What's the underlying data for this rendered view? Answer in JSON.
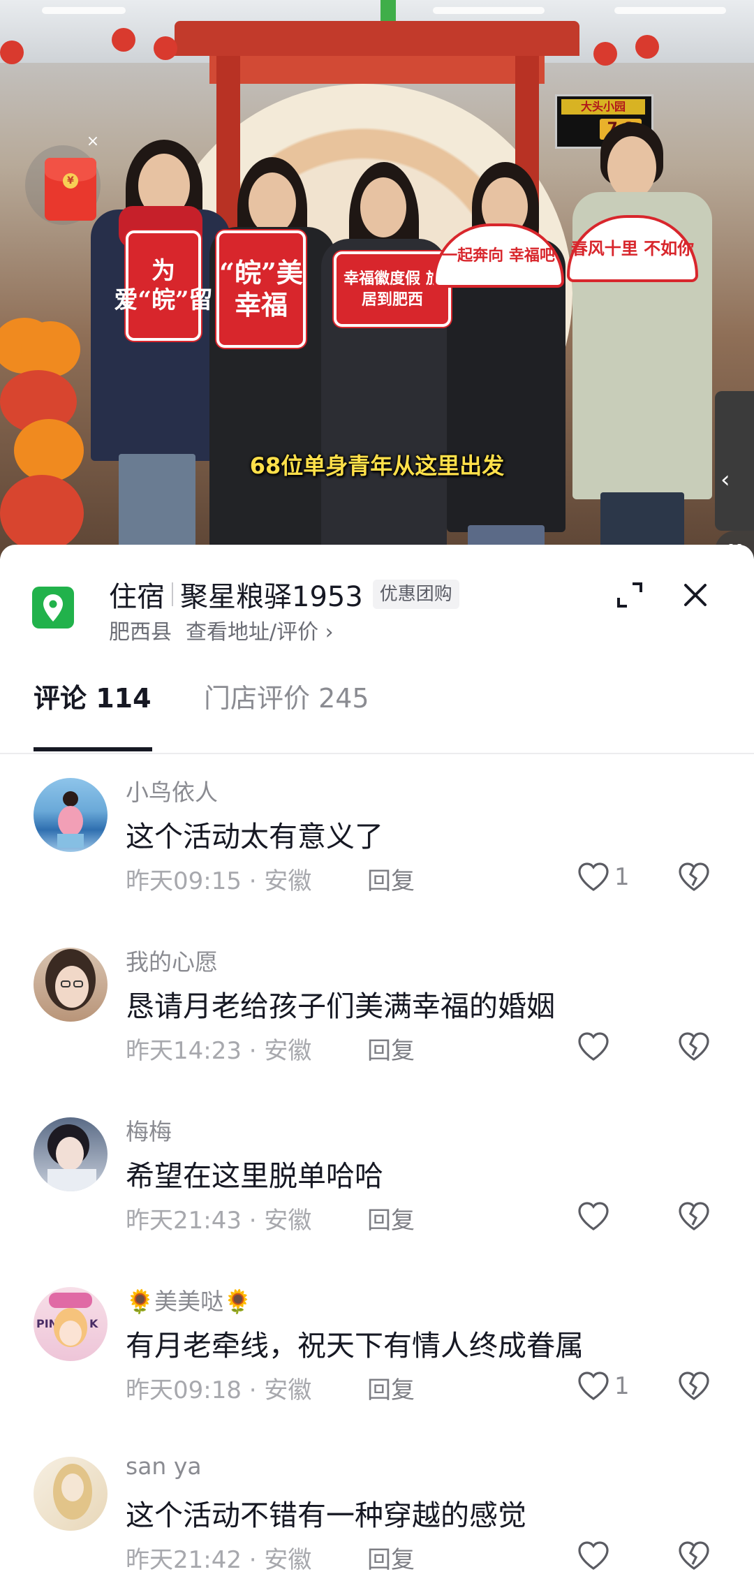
{
  "video": {
    "caption": "68位单身青年从这里出发",
    "board_title": "大头小园",
    "board_number": "7.8",
    "signs": [
      "为爱“皖”留",
      "“皖”美幸福",
      "幸福徽度假 旅居到肥西",
      "一起奔向 幸福吧",
      "春风十里 不如你"
    ]
  },
  "shop": {
    "category": "住宿",
    "name": "聚星粮驿1953",
    "badge": "优惠团购",
    "county": "肥西县",
    "address_link": "查看地址/评价 ›"
  },
  "tabs": {
    "comments": "评论 114",
    "store_reviews": "门店评价 245"
  },
  "comments": [
    {
      "name": "小鸟依人",
      "text": "这个活动太有意义了",
      "time": "昨天09:15 · 安徽",
      "reply": "回复",
      "likes": "1"
    },
    {
      "name": "我的心愿",
      "text": "恳请月老给孩子们美满幸福的婚姻",
      "time": "昨天14:23 · 安徽",
      "reply": "回复",
      "likes": ""
    },
    {
      "name": "梅梅",
      "text": "希望在这里脱单哈哈",
      "time": "昨天21:43 · 安徽",
      "reply": "回复",
      "likes": ""
    },
    {
      "name": "美美哒",
      "name_prefix": "🌻",
      "name_suffix": "🌻",
      "text": "有月老牵线，祝天下有情人终成眷属",
      "time": "昨天09:18 · 安徽",
      "reply": "回复",
      "likes": "1"
    },
    {
      "name": "san ya",
      "text": "这个活动不错有一种穿越的感觉",
      "time": "昨天21:42 · 安徽",
      "reply": "回复",
      "likes": ""
    }
  ],
  "colors": {
    "accent_green": "#21b24b",
    "text_primary": "#161823",
    "text_secondary": "#8a8b91",
    "caption_yellow": "#ffe04a"
  }
}
